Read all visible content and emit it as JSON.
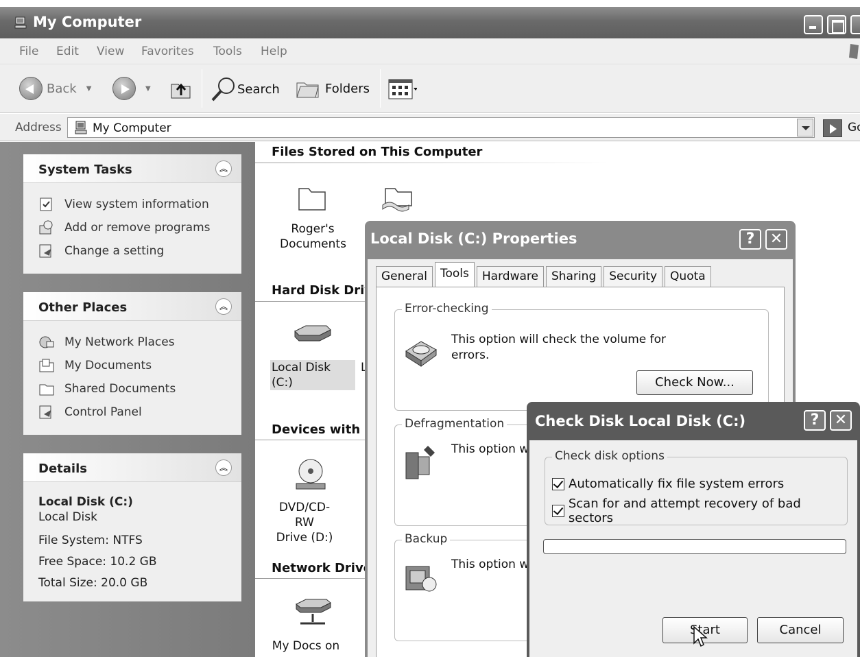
{
  "window": {
    "title": "My Computer",
    "menu": [
      "File",
      "Edit",
      "View",
      "Favorites",
      "Tools",
      "Help"
    ],
    "toolbar": {
      "back": "Back",
      "search": "Search",
      "folders": "Folders"
    },
    "address": {
      "label": "Address",
      "value": "My Computer",
      "go": "Go"
    }
  },
  "taskpane": {
    "system_tasks": {
      "title": "System Tasks",
      "items": [
        "View system information",
        "Add or remove programs",
        "Change a setting"
      ]
    },
    "other_places": {
      "title": "Other Places",
      "items": [
        "My Network Places",
        "My Documents",
        "Shared Documents",
        "Control Panel"
      ]
    },
    "details": {
      "title": "Details",
      "name": "Local Disk (C:)",
      "type": "Local Disk",
      "file_system": "File System: NTFS",
      "free_space": "Free Space: 10.2 GB",
      "total_size": "Total Size: 20.0 GB"
    }
  },
  "content": {
    "groups": {
      "files": "Files Stored on This Computer",
      "hard_disk": "Hard Disk Driv",
      "devices": "Devices with R",
      "network": "Network Drive"
    },
    "items": {
      "rogers_docs_1": "Roger's",
      "rogers_docs_2": "Documents",
      "local_disk": "Local Disk (C:)",
      "local_disk_trunc": "L",
      "dvd_1": "DVD/CD-RW",
      "dvd_2": "Drive (D:)",
      "mydocs_1": "My Docs on"
    }
  },
  "properties_dialog": {
    "title": "Local Disk (C:) Properties",
    "help": "?",
    "close": "✕",
    "tabs": [
      "General",
      "Tools",
      "Hardware",
      "Sharing",
      "Security",
      "Quota"
    ],
    "active_tab": "Tools",
    "error_checking": {
      "label": "Error-checking",
      "text_1": "This option will check the volume for",
      "text_2": "errors.",
      "button": "Check Now..."
    },
    "defrag": {
      "label": "Defragmentation",
      "text": "This option wi"
    },
    "backup": {
      "label": "Backup",
      "text": "This option wi"
    }
  },
  "checkdisk_dialog": {
    "title": "Check Disk Local Disk (C:)",
    "help": "?",
    "close": "✕",
    "group_label": "Check disk options",
    "option_1": {
      "label": "Automatically fix file system errors",
      "checked": true
    },
    "option_2": {
      "label": "Scan for and attempt recovery of bad sectors",
      "checked": true
    },
    "progress": 0,
    "start": "Start",
    "cancel": "Cancel"
  }
}
